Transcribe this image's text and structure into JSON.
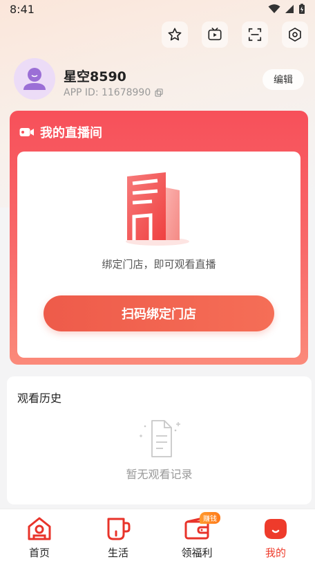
{
  "status_bar": {
    "time": "8:41"
  },
  "profile": {
    "name": "星空8590",
    "app_id_label": "APP ID: 11678990",
    "edit_label": "编辑"
  },
  "toolbar": {
    "icons": [
      "star-icon",
      "tv-play-icon",
      "scan-icon",
      "settings-hexagon-icon"
    ]
  },
  "live": {
    "title": "我的直播间",
    "hint": "绑定门店，即可观看直播",
    "bind_button": "扫码绑定门店"
  },
  "history": {
    "title": "观看历史",
    "empty_text": "暂无观看记录"
  },
  "tabs": [
    {
      "label": "首页",
      "icon": "home-icon",
      "active": false
    },
    {
      "label": "生活",
      "icon": "cup-icon",
      "active": false
    },
    {
      "label": "领福利",
      "icon": "wallet-icon",
      "active": false,
      "badge": "赚钱"
    },
    {
      "label": "我的",
      "icon": "face-icon",
      "active": true
    }
  ],
  "colors": {
    "accent": "#ee3b2b",
    "live_card": "#f7505a",
    "bind_button": "#ee5b4a",
    "badge": "#ff8a1f"
  }
}
